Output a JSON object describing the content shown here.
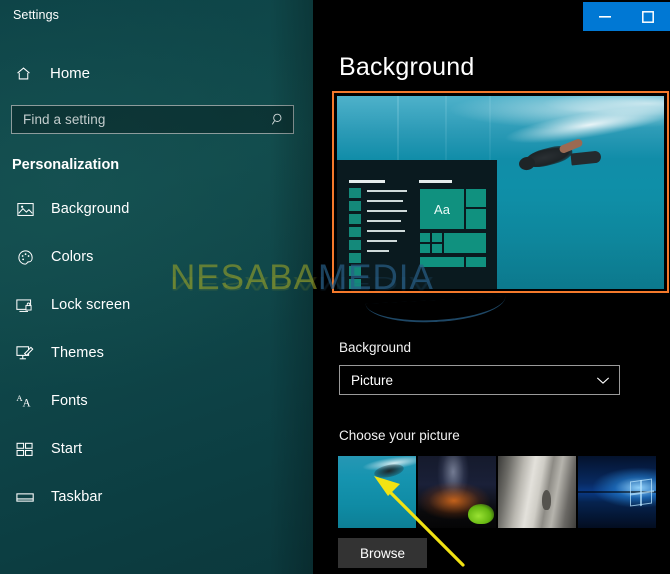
{
  "window": {
    "app_title": "Settings",
    "buttons": [
      {
        "name": "minimize",
        "glyph": "—"
      },
      {
        "name": "maximize",
        "glyph": "□"
      }
    ],
    "titlebar_accent_color": "#0078d4"
  },
  "sidebar": {
    "home_label": "Home",
    "home_icon": "home-icon",
    "search": {
      "placeholder": "Find a setting",
      "value": "",
      "icon": "search-icon"
    },
    "section_title": "Personalization",
    "items": [
      {
        "label": "Background",
        "icon": "picture-icon",
        "selected": true
      },
      {
        "label": "Colors",
        "icon": "palette-icon",
        "selected": false
      },
      {
        "label": "Lock screen",
        "icon": "lockscreen-icon",
        "selected": false
      },
      {
        "label": "Themes",
        "icon": "themes-icon",
        "selected": false
      },
      {
        "label": "Fonts",
        "icon": "fonts-icon",
        "selected": false
      },
      {
        "label": "Start",
        "icon": "start-icon",
        "selected": false
      },
      {
        "label": "Taskbar",
        "icon": "taskbar-icon",
        "selected": false
      }
    ],
    "background_color": "#0d4347"
  },
  "main": {
    "page_title": "Background",
    "preview": {
      "highlight_color": "#f4792b",
      "highlighted": true,
      "description": "Desktop preview showing underwater swimmer wallpaper with Start menu overlay",
      "start_menu_tile_color": "#10917f",
      "tile_text": "Aa"
    },
    "background_field": {
      "label": "Background",
      "selected_value": "Picture",
      "chevron_icon": "chevron-down-icon"
    },
    "choose_picture": {
      "label": "Choose your picture",
      "thumbnails": [
        {
          "name": "underwater-swimmer",
          "selected": true
        },
        {
          "name": "night-sky-tent",
          "selected": false
        },
        {
          "name": "rock-cliff",
          "selected": false
        },
        {
          "name": "windows-hero-blue",
          "selected": false
        }
      ]
    },
    "browse_button": "Browse"
  },
  "annotation": {
    "arrow_color": "#f2e313",
    "arrow_points_to": "underwater-swimmer-thumbnail"
  },
  "watermark": {
    "text_part_1": "NESABA",
    "text_part_2": "MEDIA",
    "color_1": "#96a028",
    "color_2": "#285f87"
  }
}
